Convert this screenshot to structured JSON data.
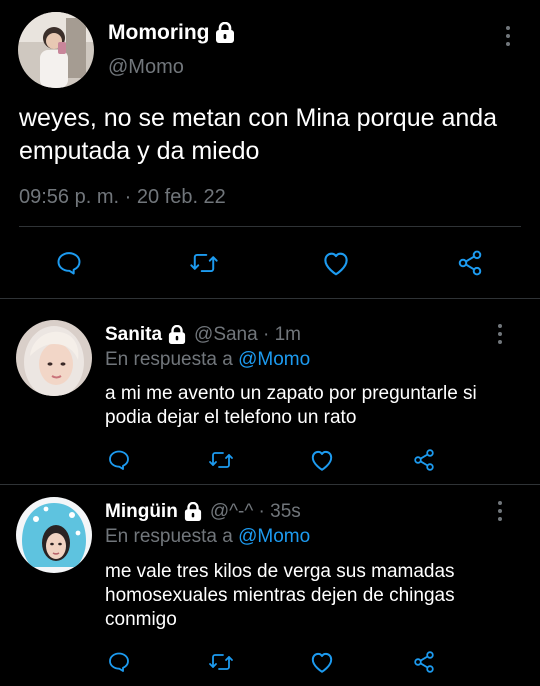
{
  "tweet": {
    "author_name": "Momoring",
    "author_handle": "@Momo",
    "text": "weyes, no se metan con Mina porque anda emputada y da miedo",
    "timestamp": "09:56 p. m. · 20 feb. 22"
  },
  "replies": [
    {
      "name": "Sanita",
      "meta": "@Sana · 1m",
      "reply_prefix": "En respuesta a",
      "reply_mention": "@Momo",
      "text": "a mi me avento un zapato por preguntarle si podia dejar el telefono un rato"
    },
    {
      "name": "Mingüin",
      "meta": "@^-^ · 35s",
      "reply_prefix": "En respuesta a",
      "reply_mention": "@Momo",
      "text": "me vale tres kilos de verga sus mamadas homosexuales mientras dejen de chingas conmigo"
    }
  ],
  "icons": {
    "lock": "lock-icon",
    "more": "more-vertical-icon",
    "reply": "reply-icon",
    "retweet": "retweet-icon",
    "like": "heart-icon",
    "share": "share-icon"
  },
  "colors": {
    "background": "#000000",
    "text": "#ffffff",
    "secondary": "#71767b",
    "link": "#1d9bf0",
    "divider": "#2f3336"
  }
}
